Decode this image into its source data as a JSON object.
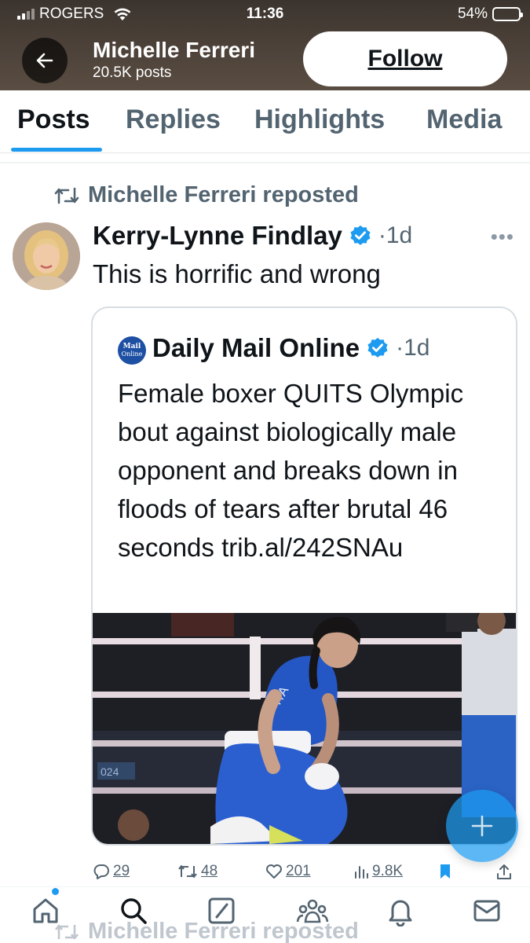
{
  "status_bar": {
    "carrier": "ROGERS",
    "time": "11:36",
    "battery": "54%",
    "battery_level": 0.54
  },
  "header": {
    "name": "Michelle Ferreri",
    "posts": "20.5K posts",
    "follow_label": "Follow"
  },
  "tabs": [
    {
      "label": "Posts",
      "active": true
    },
    {
      "label": "Replies",
      "active": false
    },
    {
      "label": "Highlights",
      "active": false
    },
    {
      "label": "Media",
      "active": false
    }
  ],
  "post": {
    "repost_text": "Michelle Ferreri reposted",
    "author": "Kerry-Lynne Findlay",
    "time": "·1d",
    "text": "This is horrific and wrong",
    "quote": {
      "logo_text": [
        "Mail",
        "Online"
      ],
      "author": "Daily Mail Online",
      "time": "·1d",
      "text": "Female boxer QUITS Olympic bout against biologically male opponent and breaks down in floods of tears after brutal 46 seconds trib.al/242SNAu",
      "image_jersey_text": "ITA",
      "image_board_text": "024"
    },
    "actions": {
      "replies": "29",
      "reposts": "48",
      "likes": "201",
      "views": "9.8K"
    }
  },
  "next_post": {
    "repost_text": "Michelle Ferreri reposted"
  },
  "colors": {
    "accent": "#1d9bf0",
    "text": "#0f1419",
    "muted": "#536471"
  },
  "icons": [
    "back-arrow-icon",
    "verified-badge-icon",
    "repost-icon",
    "more-icon",
    "reply-icon",
    "like-icon",
    "views-icon",
    "bookmark-icon",
    "share-icon",
    "compose-icon",
    "home-icon",
    "search-icon",
    "grok-icon",
    "communities-icon",
    "notifications-icon",
    "messages-icon"
  ]
}
